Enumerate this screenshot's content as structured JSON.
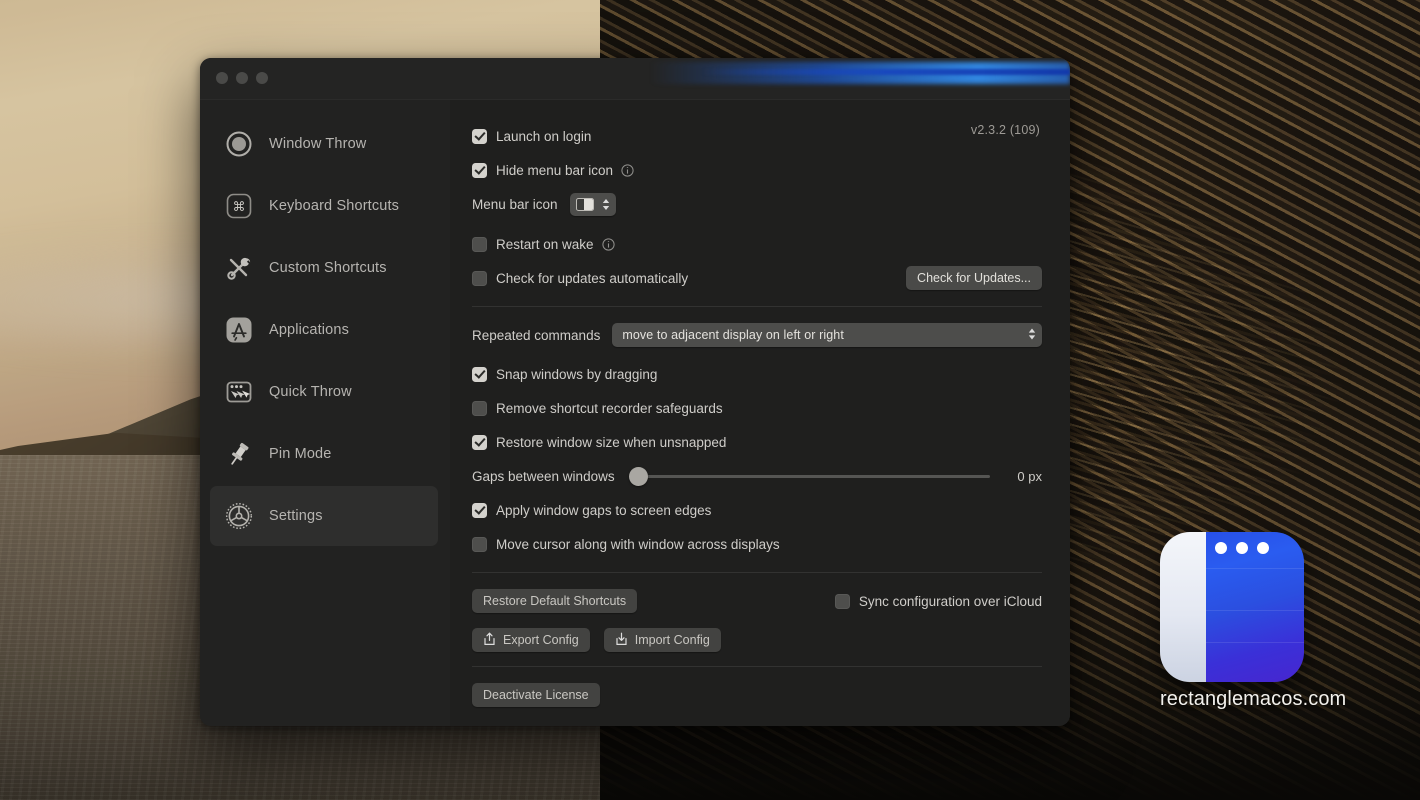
{
  "window": {
    "traffic_lights": [
      "close",
      "minimize",
      "zoom"
    ],
    "version": "v2.3.2 (109)"
  },
  "sidebar": {
    "items": [
      {
        "id": "window-throw",
        "label": "Window Throw",
        "icon": "circle-ring-icon",
        "active": false
      },
      {
        "id": "keyboard-shortcuts",
        "label": "Keyboard Shortcuts",
        "icon": "command-key-icon",
        "active": false
      },
      {
        "id": "custom-shortcuts",
        "label": "Custom Shortcuts",
        "icon": "tools-icon",
        "active": false
      },
      {
        "id": "applications",
        "label": "Applications",
        "icon": "app-store-icon",
        "active": false
      },
      {
        "id": "quick-throw",
        "label": "Quick Throw",
        "icon": "window-cursor-icon",
        "active": false
      },
      {
        "id": "pin-mode",
        "label": "Pin Mode",
        "icon": "pushpin-icon",
        "active": false
      },
      {
        "id": "settings",
        "label": "Settings",
        "icon": "gear-icon",
        "active": true
      }
    ]
  },
  "settings": {
    "launch_on_login": {
      "label": "Launch on login",
      "checked": true
    },
    "hide_menu_bar_icon": {
      "label": "Hide menu bar icon",
      "checked": true,
      "info": true
    },
    "menu_bar_icon": {
      "label": "Menu bar icon",
      "value": "split-rect-icon"
    },
    "restart_on_wake": {
      "label": "Restart on wake",
      "checked": false,
      "info": true
    },
    "check_updates_auto": {
      "label": "Check for updates automatically",
      "checked": false
    },
    "check_updates_button": "Check for Updates...",
    "repeated_commands": {
      "label": "Repeated commands",
      "value": "move to adjacent display on left or right"
    },
    "snap_by_dragging": {
      "label": "Snap windows by dragging",
      "checked": true
    },
    "remove_safeguards": {
      "label": "Remove shortcut recorder safeguards",
      "checked": false
    },
    "restore_window_size": {
      "label": "Restore window size when unsnapped",
      "checked": true
    },
    "gaps_between_windows": {
      "label": "Gaps between windows",
      "value": "0 px",
      "percent": 0
    },
    "apply_gaps_edges": {
      "label": "Apply window gaps to screen edges",
      "checked": true
    },
    "move_cursor": {
      "label": "Move cursor along with window across displays",
      "checked": false
    },
    "restore_defaults_button": "Restore Default Shortcuts",
    "sync_icloud": {
      "label": "Sync configuration over iCloud",
      "checked": false
    },
    "export_config_button": "Export Config",
    "import_config_button": "Import Config",
    "deactivate_license_button": "Deactivate License"
  },
  "desktop": {
    "app_icon_name": "rectangle-app-icon",
    "watermark": "rectanglemacos.com"
  },
  "colors": {
    "window_bg": "#1f1f1e",
    "sidebar_bg": "#222221",
    "accent_blue": "#2a5cf0",
    "control_bg": "#4d4d4b",
    "checkbox_on": "#d4d2cd"
  }
}
